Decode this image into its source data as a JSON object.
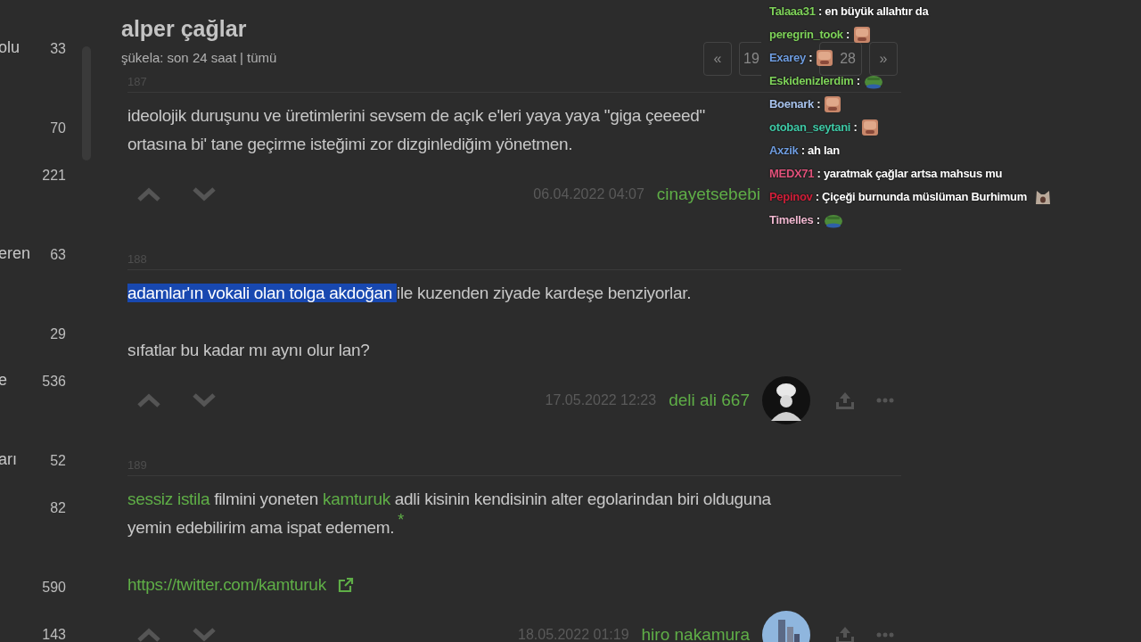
{
  "sidebar": {
    "items": [
      {
        "label": "olu",
        "count": "33",
        "kind": "short"
      },
      {
        "count": "70",
        "kind": "tall"
      },
      {
        "count": "221",
        "kind": "short"
      },
      {
        "label": "eren",
        "count": "63",
        "kind": "tall"
      },
      {
        "count": "29",
        "kind": "tall"
      },
      {
        "label": "e",
        "count": "536",
        "kind": "short"
      },
      {
        "label": "arı",
        "count": "52",
        "kind": "tall"
      },
      {
        "count": "82",
        "kind": "short"
      },
      {
        "count": "590",
        "kind": "tall"
      },
      {
        "count": "143",
        "kind": "short"
      }
    ]
  },
  "topic": {
    "title": "alper çağlar",
    "filter_label": "şükela:",
    "filters": [
      "son 24 saat",
      "tümü"
    ],
    "divider": "|"
  },
  "pagination": {
    "prev": "«",
    "page": "19",
    "total": "28",
    "next": "»"
  },
  "entries": [
    {
      "number": "187",
      "paragraphs": [
        {
          "lines": [
            [
              {
                "kind": "text",
                "text": "ideolojik duruşunu ve üretimlerini sevsem de açık e'leri yaya yaya \"giga çeeeed\""
              }
            ],
            [
              {
                "kind": "text",
                "text": "ortasına bi' tane geçirme isteğimi zor dizginlediğim yönetmen."
              }
            ]
          ]
        }
      ],
      "date": "06.04.2022 04:07",
      "author": "cinayetsebebi",
      "avatar": false
    },
    {
      "number": "188",
      "paragraphs": [
        {
          "lines": [
            [
              {
                "kind": "text",
                "text": "adamlar'ın vokali olan tolga akdoğan ",
                "selected": true
              },
              {
                "kind": "text",
                "text": "ile kuzenden ziyade kardeşe benziyorlar.",
                "selected": false
              }
            ]
          ]
        },
        {
          "lines": [
            [
              {
                "kind": "text",
                "text": "sıfatlar bu kadar mı aynı olur lan?"
              }
            ]
          ]
        }
      ],
      "date": "17.05.2022 12:23",
      "author": "deli ali 667",
      "avatar": true
    },
    {
      "number": "189",
      "paragraphs": [
        {
          "lines": [
            [
              {
                "kind": "link",
                "text": "sessiz istila"
              },
              {
                "kind": "text",
                "text": " filmini yoneten "
              },
              {
                "kind": "link",
                "text": "kamturuk"
              },
              {
                "kind": "text",
                "text": " adli kisinin kendisinin alter egolarindan biri olduguna"
              }
            ],
            [
              {
                "kind": "text",
                "text": "yemin edebilirim ama ispat edemem."
              },
              {
                "kind": "footnote",
                "text": "*"
              }
            ]
          ]
        },
        {
          "lines": [
            [
              {
                "kind": "url",
                "text": "https://twitter.com/kamturuk"
              }
            ]
          ]
        }
      ],
      "date": "18.05.2022 01:19",
      "author": "hiro nakamura",
      "avatar": true
    }
  ],
  "chat": [
    {
      "user": "Talaaa31",
      "color": "#7fd35a",
      "sep": ":",
      "text": "en büyük allahtır da",
      "emote": false
    },
    {
      "user": "peregrin_took",
      "color": "#7fd35a",
      "sep": ":",
      "emote": true
    },
    {
      "user": "Exarey",
      "color": "#6f9de0",
      "sep": ":",
      "emote": true
    },
    {
      "user": "Eskidenizlerdim",
      "color": "#7fd35a",
      "sep": ":",
      "emote": true
    },
    {
      "user": "Boenark",
      "color": "#a9c4ee",
      "sep": ":",
      "emote": true
    },
    {
      "user": "otoban_seytani",
      "color": "#3fc9a6",
      "sep": ":",
      "emote": true
    },
    {
      "user": "Axzik",
      "color": "#6f9de0",
      "sep": ":",
      "text": "ah lan",
      "emote": false
    },
    {
      "user": "MEDX71",
      "color": "#e0527a",
      "sep": ":",
      "text": "yaratmak çağlar artsa mahsus mu",
      "emote": false
    },
    {
      "user": "Pepinov",
      "color": "#d0203a",
      "sep": ":",
      "text": "Çiçeği burnunda müslüman Burhimum",
      "emote": true
    },
    {
      "user": "Timelles",
      "color": "#f0b8d0",
      "sep": ":",
      "emote": true
    }
  ]
}
